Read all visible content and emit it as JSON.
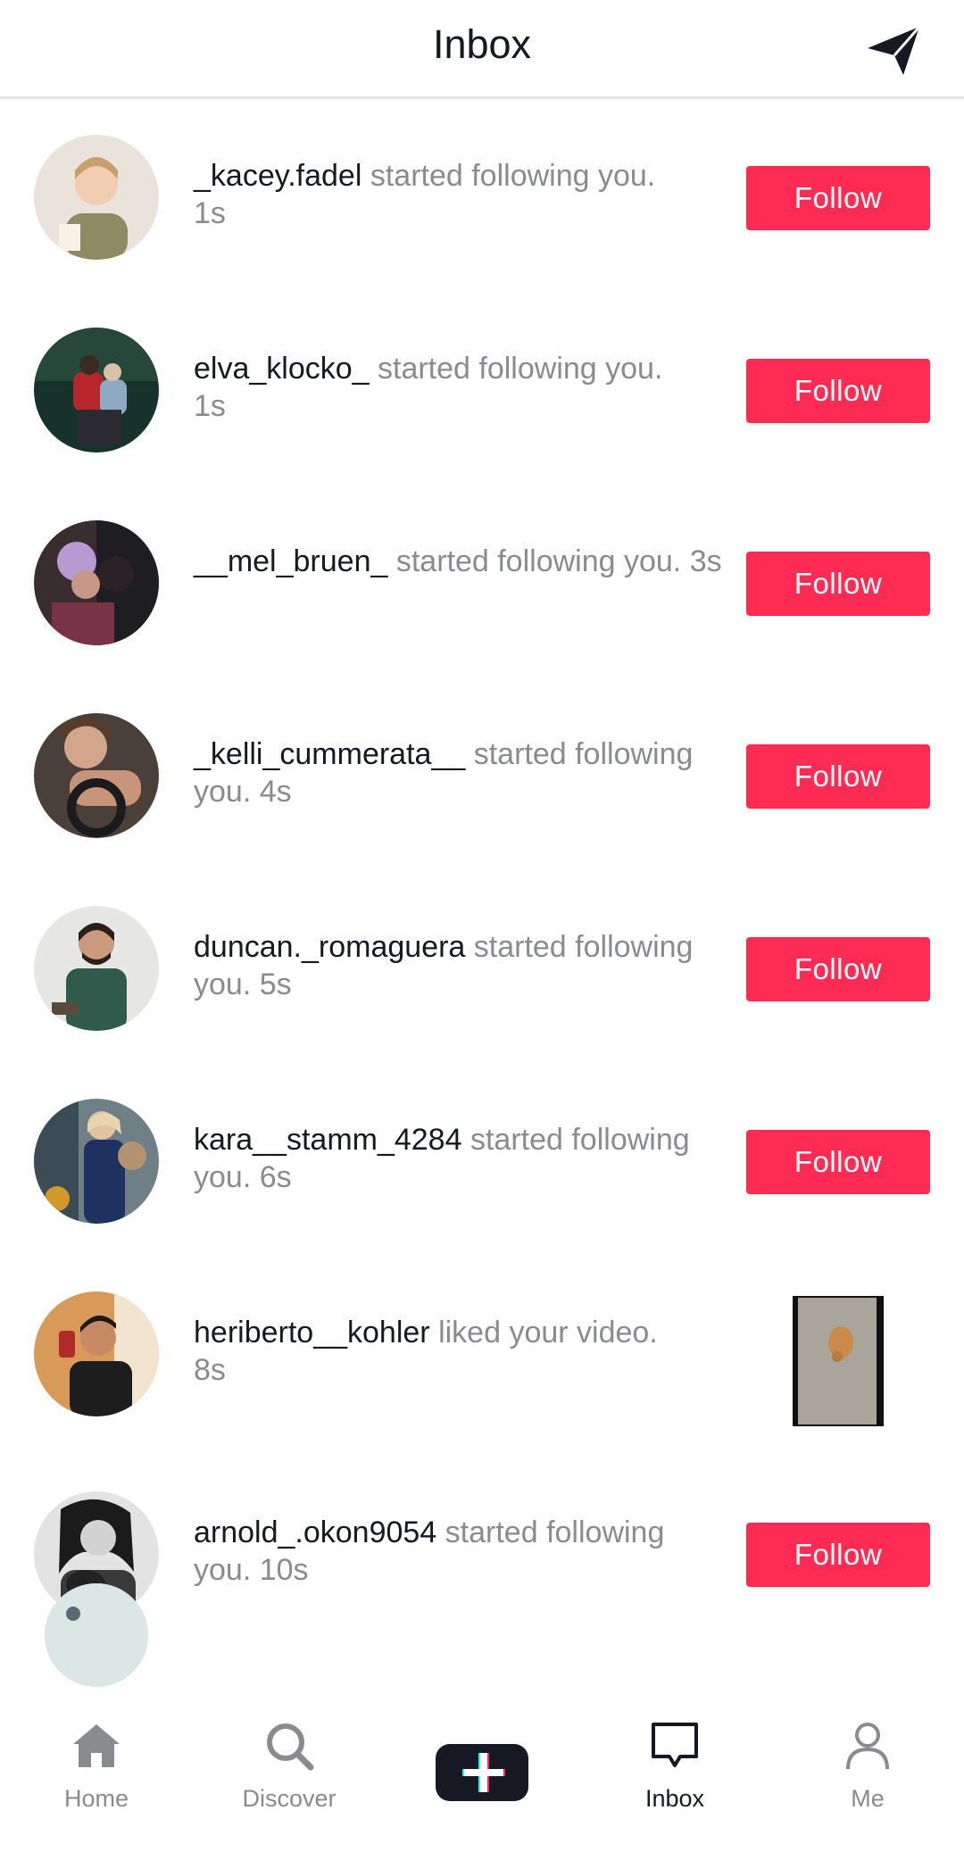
{
  "header": {
    "title": "Inbox",
    "send_icon": "paper-plane-icon"
  },
  "notifications": [
    {
      "username": "_kacey.fadel",
      "action": " started following you.",
      "time": "1s",
      "button": "Follow"
    },
    {
      "username": "elva_klocko_",
      "action": " started following you.",
      "time": "1s",
      "button": "Follow"
    },
    {
      "username": "__mel_bruen_",
      "action": " started following you.",
      "time": "3s",
      "button": "Follow"
    },
    {
      "username": "_kelli_cummerata__",
      "action": " started following you.",
      "time": "4s",
      "button": "Follow"
    },
    {
      "username": "duncan._romaguera",
      "action": " started following you.",
      "time": "5s",
      "button": "Follow"
    },
    {
      "username": "kara__stamm_4284",
      "action": " started following you.",
      "time": "6s",
      "button": "Follow"
    },
    {
      "username": "heriberto__kohler",
      "action": " liked your video.",
      "time": "8s"
    },
    {
      "username": "arnold_.okon9054",
      "action": " started following you.",
      "time": "10s",
      "button": "Follow"
    }
  ],
  "tabbar": {
    "home": "Home",
    "discover": "Discover",
    "inbox": "Inbox",
    "me": "Me"
  },
  "colors": {
    "accent": "#fe2c55",
    "text": "#161823",
    "muted": "#8a8b91"
  }
}
